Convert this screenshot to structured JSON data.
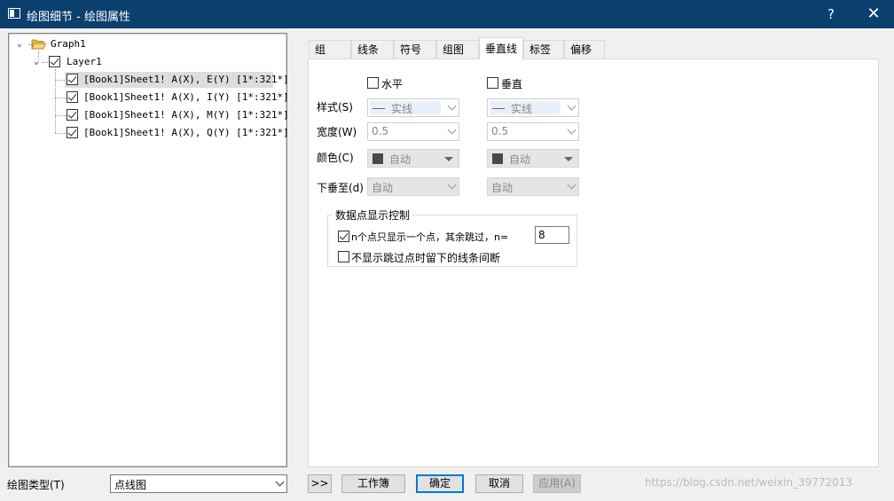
{
  "window": {
    "title": "绘图细节 - 绘图属性",
    "help_label": "?",
    "close_label": "✕"
  },
  "tree": {
    "graph": "Graph1",
    "layer": "Layer1",
    "plots": [
      "[Book1]Sheet1! A(X), E(Y) [1*:321*]",
      "[Book1]Sheet1! A(X), I(Y) [1*:321*]",
      "[Book1]Sheet1! A(X), M(Y) [1*:321*]",
      "[Book1]Sheet1! A(X), Q(Y) [1*:321*]"
    ]
  },
  "tabs": [
    "组",
    "线条",
    "符号",
    "组图",
    "垂直线",
    "标签",
    "偏移"
  ],
  "active_tab": "垂直线",
  "panel": {
    "horizontal_label": "水平",
    "vertical_label": "垂直",
    "style_label": "样式(S)",
    "width_label": "宽度(W)",
    "color_label": "颜色(C)",
    "dropto_label": "下垂至(d)",
    "style_value": "实线",
    "width_value": "0.5",
    "color_value": "自动",
    "dropto_value": "自动",
    "group_title": "数据点显示控制",
    "skip_label": "n个点只显示一个点，其余跳过，n=",
    "skip_n": "8",
    "nogap_label": "不显示跳过点时留下的线条间断"
  },
  "bottom": {
    "plot_type_label": "绘图类型(T)",
    "plot_type_value": "点线图",
    "expand_label": ">>",
    "workbook_label": "工作簿",
    "ok_label": "确定",
    "cancel_label": "取消",
    "apply_label": "应用(A)"
  },
  "watermark": "https://blog.csdn.net/weixin_39772013"
}
